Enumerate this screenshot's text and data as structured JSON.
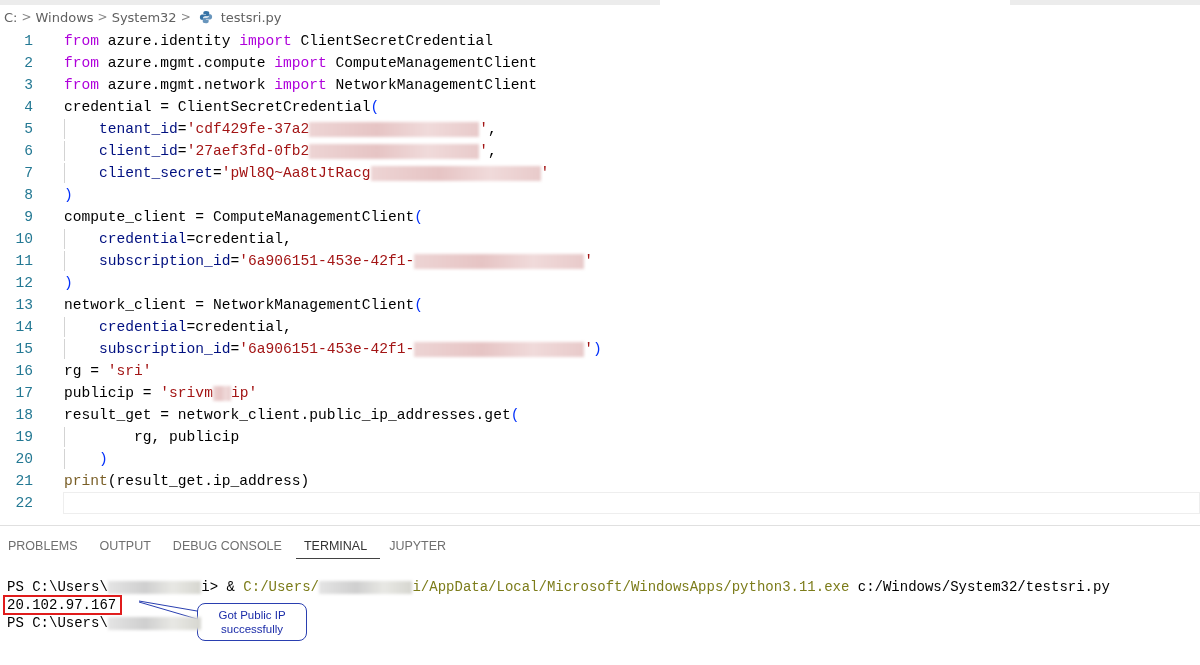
{
  "breadcrumb": {
    "parts": [
      {
        "kind": "folder",
        "label": "C:"
      },
      {
        "kind": "folder",
        "label": "Windows"
      },
      {
        "kind": "folder",
        "label": "System32"
      },
      {
        "kind": "python-file",
        "label": "testsri.py"
      }
    ],
    "separator": ">"
  },
  "editor": {
    "lines": [
      {
        "number": "1",
        "current": false,
        "tokens": [
          {
            "kind": "keyword",
            "text": "from"
          },
          {
            "kind": "plain",
            "text": " azure.identity "
          },
          {
            "kind": "keyword",
            "text": "import"
          },
          {
            "kind": "plain",
            "text": " ClientSecretCredential"
          }
        ]
      },
      {
        "number": "2",
        "current": false,
        "tokens": [
          {
            "kind": "keyword",
            "text": "from"
          },
          {
            "kind": "plain",
            "text": " azure.mgmt.compute "
          },
          {
            "kind": "keyword",
            "text": "import"
          },
          {
            "kind": "plain",
            "text": " ComputeManagementClient"
          }
        ]
      },
      {
        "number": "3",
        "current": false,
        "tokens": [
          {
            "kind": "keyword",
            "text": "from"
          },
          {
            "kind": "plain",
            "text": " azure.mgmt.network "
          },
          {
            "kind": "keyword",
            "text": "import"
          },
          {
            "kind": "plain",
            "text": " NetworkManagementClient"
          }
        ]
      },
      {
        "number": "4",
        "current": false,
        "tokens": [
          {
            "kind": "plain",
            "text": "credential = ClientSecretCredential"
          },
          {
            "kind": "bracket",
            "text": "("
          }
        ]
      },
      {
        "number": "5",
        "current": false,
        "tokens": [
          {
            "kind": "param",
            "text": "    tenant_id"
          },
          {
            "kind": "plain",
            "text": "="
          },
          {
            "kind": "string",
            "text": "'cdf429fe-37a2"
          },
          {
            "kind": "redacted"
          },
          {
            "kind": "string",
            "text": "'"
          },
          {
            "kind": "plain",
            "text": ","
          }
        ]
      },
      {
        "number": "6",
        "current": false,
        "tokens": [
          {
            "kind": "param",
            "text": "    client_id"
          },
          {
            "kind": "plain",
            "text": "="
          },
          {
            "kind": "string",
            "text": "'27aef3fd-0fb2"
          },
          {
            "kind": "redacted"
          },
          {
            "kind": "string",
            "text": "'"
          },
          {
            "kind": "plain",
            "text": ","
          }
        ]
      },
      {
        "number": "7",
        "current": false,
        "tokens": [
          {
            "kind": "param",
            "text": "    client_secret"
          },
          {
            "kind": "plain",
            "text": "="
          },
          {
            "kind": "string",
            "text": "'pWl8Q~Aa8tJtRacg"
          },
          {
            "kind": "redacted"
          },
          {
            "kind": "string",
            "text": "'"
          }
        ]
      },
      {
        "number": "8",
        "current": false,
        "tokens": [
          {
            "kind": "bracket",
            "text": ")"
          }
        ]
      },
      {
        "number": "9",
        "current": false,
        "tokens": [
          {
            "kind": "plain",
            "text": "compute_client = ComputeManagementClient"
          },
          {
            "kind": "bracket",
            "text": "("
          }
        ]
      },
      {
        "number": "10",
        "current": false,
        "tokens": [
          {
            "kind": "param",
            "text": "    credential"
          },
          {
            "kind": "plain",
            "text": "=credential,"
          }
        ]
      },
      {
        "number": "11",
        "current": false,
        "tokens": [
          {
            "kind": "param",
            "text": "    subscription_id"
          },
          {
            "kind": "plain",
            "text": "="
          },
          {
            "kind": "string",
            "text": "'6a906151-453e-42f1-"
          },
          {
            "kind": "redacted"
          },
          {
            "kind": "string",
            "text": "'"
          }
        ]
      },
      {
        "number": "12",
        "current": false,
        "tokens": [
          {
            "kind": "bracket",
            "text": ")"
          }
        ]
      },
      {
        "number": "13",
        "current": false,
        "tokens": [
          {
            "kind": "plain",
            "text": "network_client = NetworkManagementClient"
          },
          {
            "kind": "bracket",
            "text": "("
          }
        ]
      },
      {
        "number": "14",
        "current": false,
        "tokens": [
          {
            "kind": "param",
            "text": "    credential"
          },
          {
            "kind": "plain",
            "text": "=credential,"
          }
        ]
      },
      {
        "number": "15",
        "current": false,
        "tokens": [
          {
            "kind": "param",
            "text": "    subscription_id"
          },
          {
            "kind": "plain",
            "text": "="
          },
          {
            "kind": "string",
            "text": "'6a906151-453e-42f1-"
          },
          {
            "kind": "redacted"
          },
          {
            "kind": "string",
            "text": "'"
          },
          {
            "kind": "bracket",
            "text": ")"
          }
        ]
      },
      {
        "number": "16",
        "current": false,
        "tokens": [
          {
            "kind": "plain",
            "text": "rg = "
          },
          {
            "kind": "string",
            "text": "'sri'"
          }
        ]
      },
      {
        "number": "17",
        "current": false,
        "tokens": [
          {
            "kind": "plain",
            "text": "publicip = "
          },
          {
            "kind": "string",
            "text": "'srivm"
          },
          {
            "kind": "masked"
          },
          {
            "kind": "string",
            "text": "ip'"
          }
        ]
      },
      {
        "number": "18",
        "current": false,
        "tokens": [
          {
            "kind": "plain",
            "text": "result_get = network_client.public_ip_addresses.get"
          },
          {
            "kind": "bracket",
            "text": "("
          }
        ]
      },
      {
        "number": "19",
        "current": false,
        "tokens": [
          {
            "kind": "plain",
            "text": "        rg, publicip"
          }
        ]
      },
      {
        "number": "20",
        "current": false,
        "tokens": [
          {
            "kind": "bracket",
            "text": "    )"
          }
        ]
      },
      {
        "number": "21",
        "current": false,
        "tokens": [
          {
            "kind": "function",
            "text": "print"
          },
          {
            "kind": "plain",
            "text": "(result_get.ip_address)"
          }
        ]
      },
      {
        "number": "22",
        "current": true
      }
    ]
  },
  "panel": {
    "tabs": [
      {
        "label": "PROBLEMS",
        "selected": false
      },
      {
        "label": "OUTPUT",
        "selected": false
      },
      {
        "label": "DEBUG CONSOLE",
        "selected": false
      },
      {
        "label": "TERMINAL",
        "selected": true
      },
      {
        "label": "JUPYTER",
        "selected": false
      }
    ],
    "terminal": [
      {
        "highlighted": false,
        "tokens": [
          {
            "kind": "plain",
            "text": "PS C:\\Users\\"
          },
          {
            "kind": "redacted"
          },
          {
            "kind": "plain",
            "text": "i> & "
          },
          {
            "kind": "path",
            "text": "C:/Users/"
          },
          {
            "kind": "redacted"
          },
          {
            "kind": "path",
            "text": "i/AppData/Local/Microsoft/WindowsApps/python3.11.exe"
          },
          {
            "kind": "plain",
            "text": " c:/Windows/System32/testsri.py"
          }
        ]
      },
      {
        "highlighted": true,
        "tokens": [
          {
            "kind": "plain",
            "text": "20.102.97.167"
          }
        ]
      },
      {
        "highlighted": false,
        "tokens": [
          {
            "kind": "plain",
            "text": "PS C:\\Users\\"
          },
          {
            "kind": "redacted"
          }
        ]
      }
    ],
    "callout": {
      "lines": [
        "Got Public IP",
        "successfully"
      ]
    }
  }
}
